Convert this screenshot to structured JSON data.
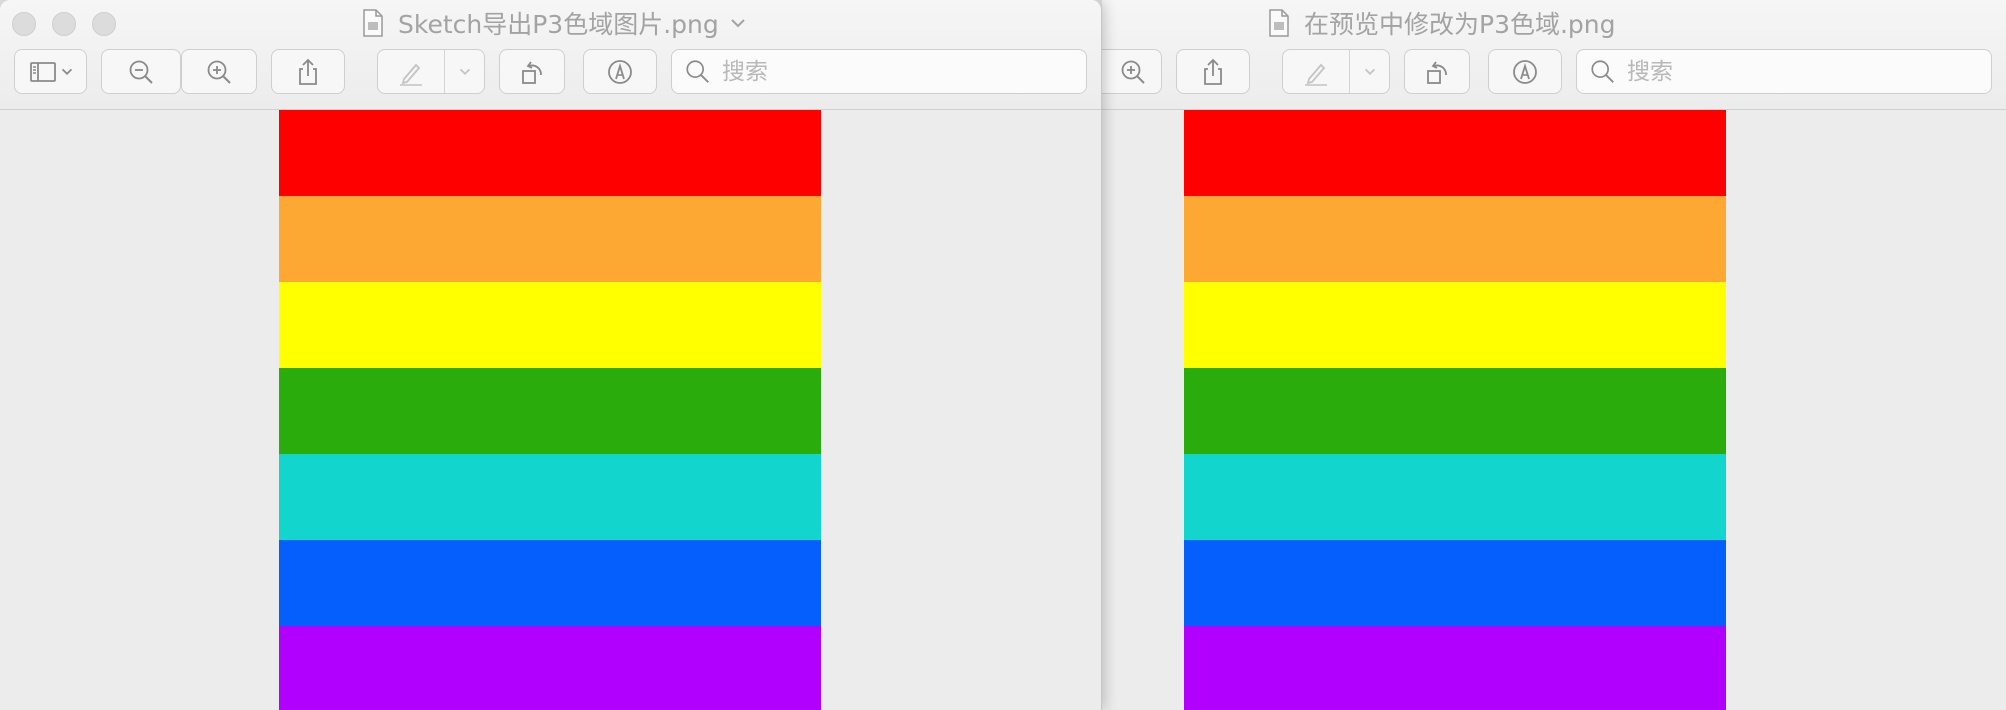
{
  "left_window": {
    "title": "Sketch导出P3色域图片.png",
    "search_placeholder": "搜索"
  },
  "right_window": {
    "title": "在预览中修改为P3色域.png",
    "search_placeholder": "搜索"
  },
  "icons": {
    "toolbar": [
      "sidebar-icon",
      "chevron-down-icon",
      "zoom-out-icon",
      "zoom-in-icon",
      "share-icon",
      "markup-pen-icon",
      "rotate-icon",
      "annotate-icon",
      "search-icon"
    ],
    "title": [
      "document-icon",
      "chevron-down-icon"
    ]
  },
  "colors": {
    "chrome_background": "#ededed",
    "toolbar_icon": "#8a8a8a",
    "title_text": "#a3a3a3"
  },
  "rainbow_stripes": [
    "#ff0000",
    "#fca832",
    "#ffff00",
    "#2aad0c",
    "#12d6ce",
    "#045ffd",
    "#b200ff"
  ]
}
